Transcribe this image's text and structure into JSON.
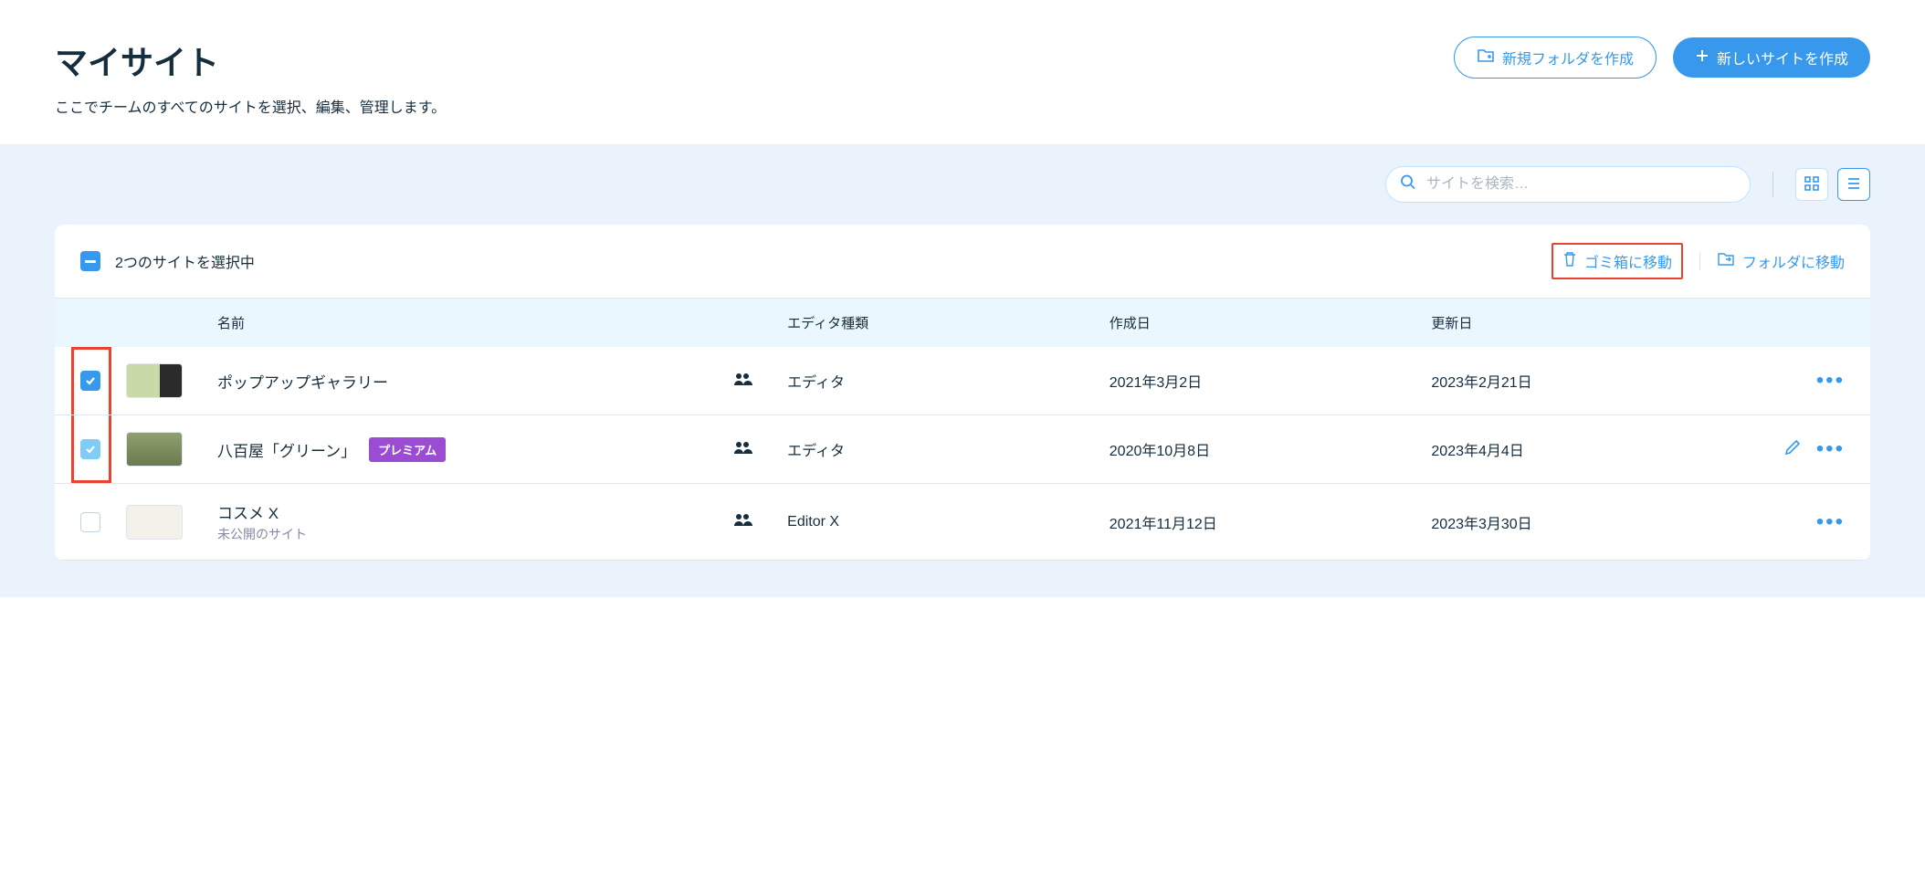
{
  "header": {
    "title": "マイサイト",
    "subtitle": "ここでチームのすべてのサイトを選択、編集、管理します。",
    "new_folder_label": "新規フォルダを作成",
    "new_site_label": "新しいサイトを作成"
  },
  "toolbar": {
    "search_placeholder": "サイトを検索…"
  },
  "selection": {
    "count_text": "2つのサイトを選択中",
    "trash_label": "ゴミ箱に移動",
    "folder_label": "フォルダに移動"
  },
  "columns": {
    "name": "名前",
    "editor_type": "エディタ種類",
    "created": "作成日",
    "updated": "更新日"
  },
  "badges": {
    "premium": "プレミアム"
  },
  "rows": [
    {
      "checked": true,
      "checked_style": "checked",
      "name": "ポップアップギャラリー",
      "sub": "",
      "premium": false,
      "shared": true,
      "editor": "エディタ",
      "created": "2021年3月2日",
      "updated": "2023年2月21日",
      "edit_icon": false
    },
    {
      "checked": true,
      "checked_style": "checked-light",
      "name": "八百屋「グリーン」",
      "sub": "",
      "premium": true,
      "shared": true,
      "editor": "エディタ",
      "created": "2020年10月8日",
      "updated": "2023年4月4日",
      "edit_icon": true
    },
    {
      "checked": false,
      "checked_style": "unchecked",
      "name": "コスメ X",
      "sub": "未公開のサイト",
      "premium": false,
      "shared": true,
      "editor": "Editor X",
      "created": "2021年11月12日",
      "updated": "2023年3月30日",
      "edit_icon": false
    }
  ]
}
